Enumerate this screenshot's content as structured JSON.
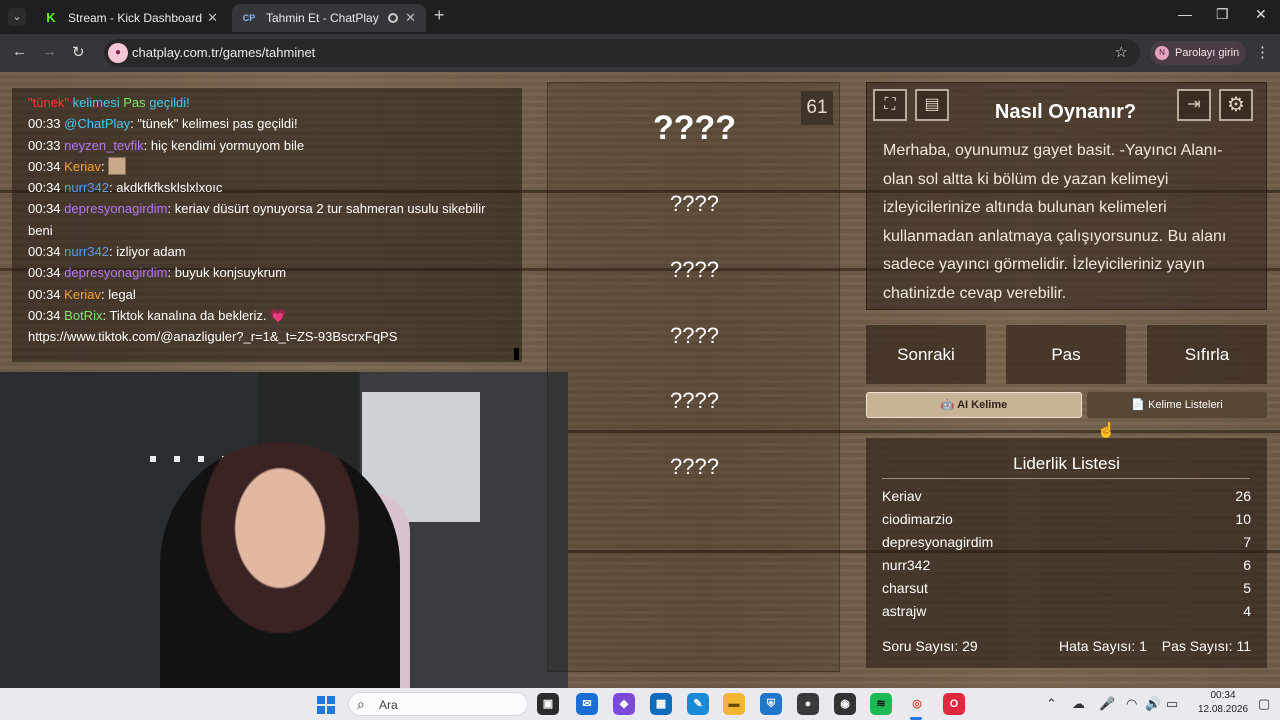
{
  "browser": {
    "tabs": [
      {
        "title": "Stream - Kick Dashboard",
        "favicon": "K"
      },
      {
        "title": "Tahmin Et - ChatPlay",
        "favicon": "CP"
      }
    ],
    "url": "chatplay.com.tr/games/tahminet",
    "password_chip": "Parolayı girin",
    "password_avatar": "N"
  },
  "chat": {
    "header": {
      "word": "\"tünek\"",
      "mid": " kelimesi ",
      "pas": "Pas",
      "end": " geçildi!"
    },
    "lines": [
      {
        "time": "00:33",
        "user": "@ChatPlay",
        "sep": ": ",
        "msg": "\"tünek\" kelimesi pas geçildi!"
      },
      {
        "time": "00:33",
        "user": "neyzen_tevfik",
        "sep": ": ",
        "msg": "hiç kendimi yormuyom bile"
      },
      {
        "time": "00:34",
        "user": "Keriav",
        "sep": ": ",
        "msg": ""
      },
      {
        "time": "00:34",
        "user": "nurr342",
        "sep": ": ",
        "msg": "akdkfkfksklslxlxoıc"
      },
      {
        "time": "00:34",
        "user": "depresyonagirdim",
        "sep": ": ",
        "msg": "keriav düsürt oynuyorsa 2 tur sahmeran usulu sikebilir beni"
      },
      {
        "time": "00:34",
        "user": "nurr342",
        "sep": ": ",
        "msg": "izliyor adam"
      },
      {
        "time": "00:34",
        "user": "depresyonagirdim",
        "sep": ": ",
        "msg": "buyuk konjsuykrum"
      },
      {
        "time": "00:34",
        "user": "Keriav",
        "sep": ": ",
        "msg": "legal"
      },
      {
        "time": "00:34",
        "user": "BotRix",
        "sep": ": ",
        "msg": "Tiktok kanalına da bekleriz. 💗"
      }
    ],
    "link": "https://www.tiktok.com/@anazliguler?_r=1&_t=ZS-93BscrxFqPS"
  },
  "words": {
    "count": "61",
    "items": [
      "????",
      "????",
      "????",
      "????",
      "????",
      "????"
    ]
  },
  "howto": {
    "title": "Nasıl Oynanır?",
    "text": "Merhaba, oyunumuz gayet basit. -Yayıncı Alanı- olan sol altta ki bölüm de yazan kelimeyi izleyicilerinize altında bulunan kelimeleri kullanmadan anlatmaya çalışıyorsunuz. Bu alanı sadece yayıncı görmelidir. İzleyicileriniz yayın chatinizde cevap verebilir."
  },
  "actions": {
    "next": "Sonraki",
    "pass": "Pas",
    "reset": "Sıfırla"
  },
  "tabs": {
    "ai": "🤖 AI Kelime",
    "lists": "📄 Kelime Listeleri"
  },
  "leaderboard": {
    "title": "Liderlik Listesi",
    "rows": [
      {
        "name": "Keriav",
        "score": "26"
      },
      {
        "name": "ciodimarzio",
        "score": "10"
      },
      {
        "name": "depresyonagirdim",
        "score": "7"
      },
      {
        "name": "nurr342",
        "score": "6"
      },
      {
        "name": "charsut",
        "score": "5"
      },
      {
        "name": "astrajw",
        "score": "4"
      }
    ],
    "stats": {
      "questions": "Soru Sayısı: 29",
      "errors": "Hata Sayısı: 1",
      "passes": "Pas Sayısı: 11"
    }
  },
  "taskbar": {
    "search": "Ara",
    "time": "00:34",
    "date": "12.08.2026"
  },
  "colors": {
    "accent": "#2b77e4",
    "kick_green": "#53fc18",
    "wood": "#6e5b47"
  }
}
